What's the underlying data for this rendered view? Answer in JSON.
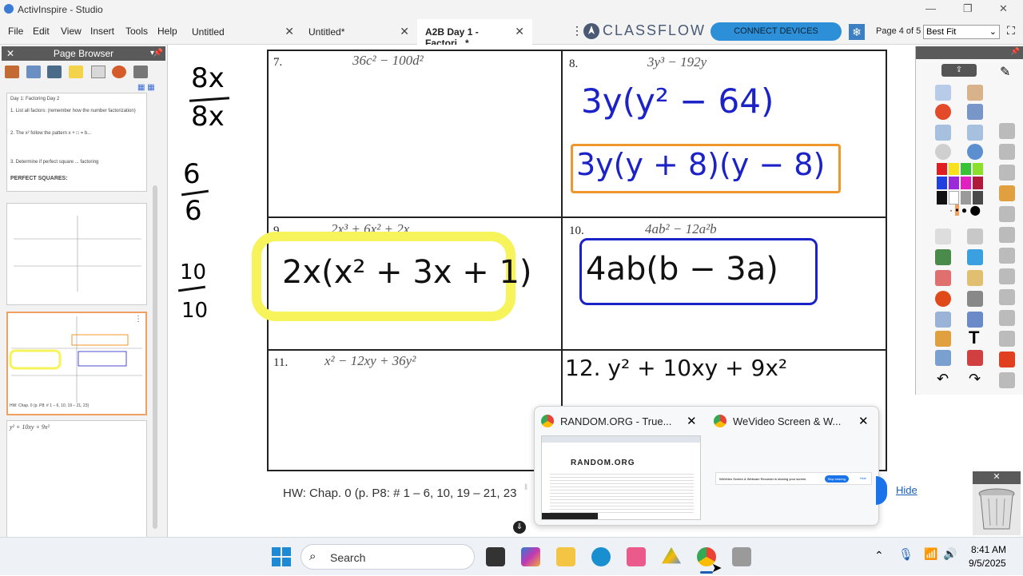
{
  "app": {
    "title": "ActivInspire - Studio"
  },
  "menu": [
    "File",
    "Edit",
    "View",
    "Insert",
    "Tools",
    "Help"
  ],
  "tabs": [
    {
      "label": "Untitled"
    },
    {
      "label": "Untitled*"
    },
    {
      "label": "A2B Day 1 - Factori...*"
    }
  ],
  "classflow": {
    "logo": "CLASSFLOW",
    "connect": "CONNECT DEVICES"
  },
  "page_indicator": "Page 4 of 5",
  "zoom": "Best Fit",
  "page_browser": {
    "title": "Page Browser",
    "thumb1_lines": [
      "Day 1: Factoring Day 2",
      "1. List all factors: (remember how the number factorization)",
      "2. The x² follow the pattern x + □ = b...",
      "3. Determine if perfect square ... factoring",
      "PERFECT SQUARES:"
    ],
    "thumb4_text": "HW: Chap. 0 (p. P8: # 1 – 6, 10, 19 – 21, 23)",
    "thumb5_text": "y² + 10xy + 9x²"
  },
  "margin_notes": [
    "8x",
    "8x",
    "6",
    "6",
    "10",
    "10"
  ],
  "worksheet": {
    "cells": [
      {
        "num": "7.",
        "expr": "36c² − 100d²"
      },
      {
        "num": "8.",
        "expr": "3y³ − 192y"
      },
      {
        "num": "9.",
        "expr": "2x³ + 6x² + 2x"
      },
      {
        "num": "10.",
        "expr": "4ab² − 12a²b"
      },
      {
        "num": "11.",
        "expr": "x² − 12xy + 36y²"
      },
      {
        "num": "12.",
        "expr": ""
      }
    ],
    "ink8a": "3y(y² − 64)",
    "ink8b": "3y(y + 8)(y − 8)",
    "ink9": "2x(x² + 3x + 1)",
    "ink10": "4ab(b − 3a)",
    "ink12": "12. y² + 10xy + 9x²",
    "hw": "HW: Chap. 0 (p. P8: # 1 – 6, 10, 19 – 21, 23"
  },
  "popup": {
    "tab1": "RANDOM.ORG - True...",
    "tab2": "WeVideo Screen & W...",
    "sharing_text": "WeVideo Screen & Webcam Recorder is sharing your screen.",
    "stop_sharing": "Stop sharing",
    "hide_small": "Hide",
    "random_logo": "RANDOM.ORG"
  },
  "hide_link": "Hide",
  "taskbar": {
    "search": "Search",
    "time": "8:41 AM",
    "date": "9/5/2025"
  },
  "colors": {
    "ink_blue": "#1b22c8",
    "orange": "#f0962a",
    "highlight": "#f6f45a",
    "connect": "#2c8fd8"
  }
}
